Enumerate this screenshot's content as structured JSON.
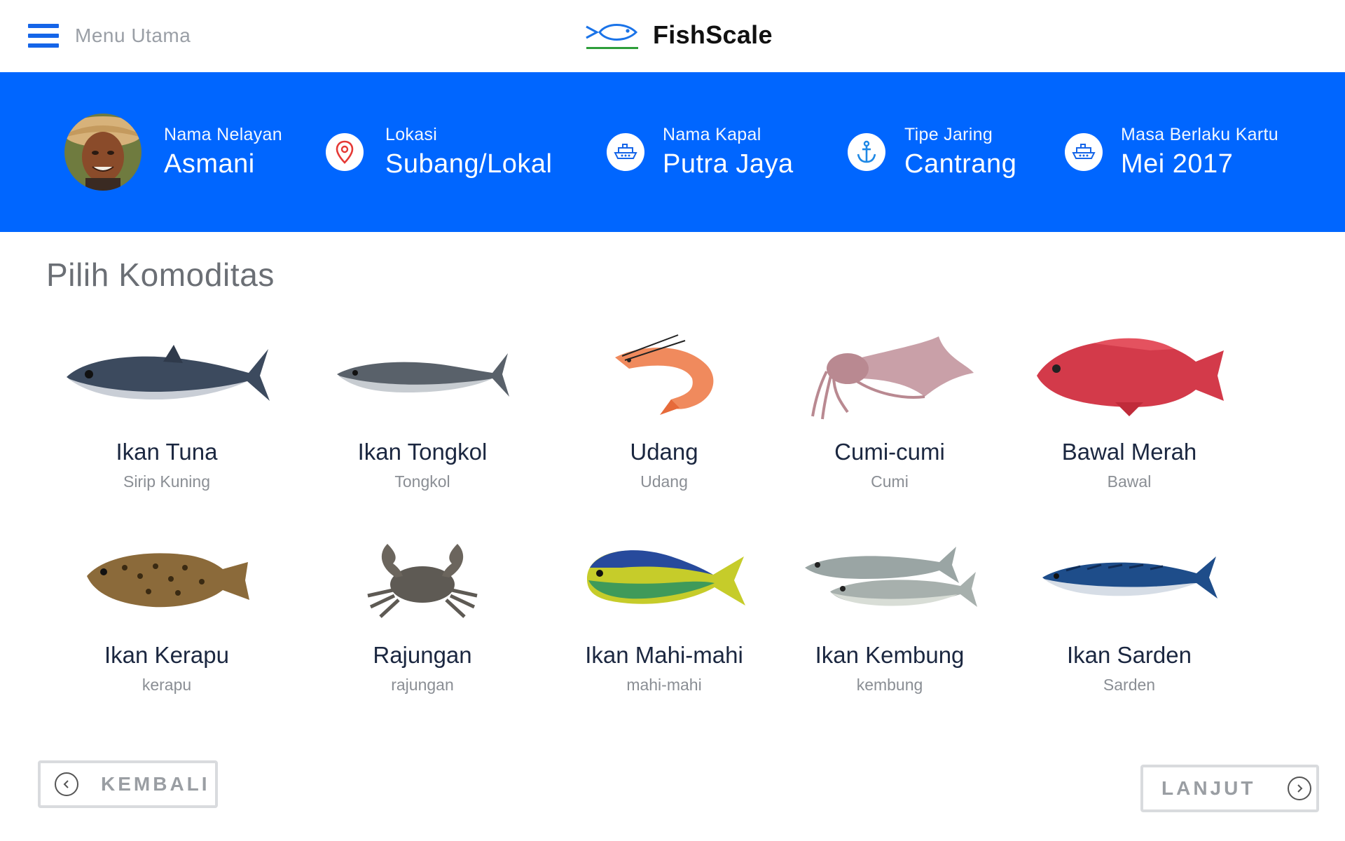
{
  "topbar": {
    "menu_label": "Menu Utama",
    "brand_name": "FishScale"
  },
  "profile": {
    "fisher_label": "Nama Nelayan",
    "fisher_name": "Asmani",
    "location_label": "Lokasi",
    "location_value": "Subang/Lokal",
    "ship_label": "Nama Kapal",
    "ship_value": "Putra Jaya",
    "net_label": "Tipe Jaring",
    "net_value": "Cantrang",
    "card_label": "Masa Berlaku Kartu",
    "card_value": "Mei 2017"
  },
  "section_title": "Pilih Komoditas",
  "commodities": [
    {
      "name": "Ikan Tuna",
      "sub": "Sirip Kuning",
      "icon": "tuna-fish"
    },
    {
      "name": "Ikan Tongkol",
      "sub": "Tongkol",
      "icon": "tongkol-fish"
    },
    {
      "name": "Udang",
      "sub": "Udang",
      "icon": "shrimp"
    },
    {
      "name": "Cumi-cumi",
      "sub": "Cumi",
      "icon": "squid"
    },
    {
      "name": "Bawal Merah",
      "sub": "Bawal",
      "icon": "red-snapper"
    },
    {
      "name": "Ikan Kerapu",
      "sub": "kerapu",
      "icon": "grouper"
    },
    {
      "name": "Rajungan",
      "sub": "rajungan",
      "icon": "crab"
    },
    {
      "name": "Ikan Mahi-mahi",
      "sub": "mahi-mahi",
      "icon": "mahi-mahi"
    },
    {
      "name": "Ikan Kembung",
      "sub": "kembung",
      "icon": "mackerel-pair"
    },
    {
      "name": "Ikan Sarden",
      "sub": "Sarden",
      "icon": "sardine"
    }
  ],
  "footer": {
    "back_label": "KEMBALI",
    "next_label": "LANJUT"
  },
  "colors": {
    "primary": "#0066ff",
    "icon_red": "#e53935",
    "icon_blue": "#1565e8"
  }
}
